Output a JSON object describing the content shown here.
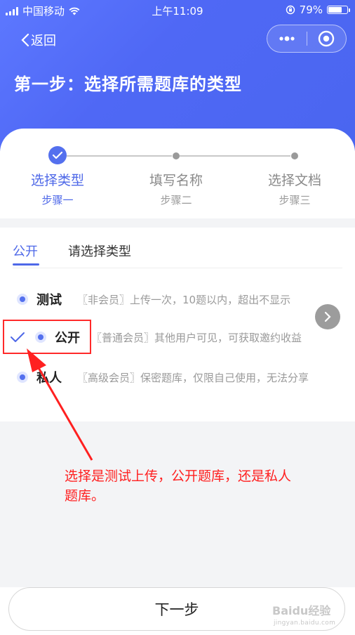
{
  "status_bar": {
    "carrier": "中国移动",
    "time": "上午11:09",
    "battery_text": "79%",
    "battery_level": 0.79
  },
  "nav": {
    "back_label": "返回",
    "more_icon": "more-dots-icon",
    "close_icon": "target-circle-icon"
  },
  "header": {
    "title": "第一步：选择所需题库的类型"
  },
  "steps": [
    {
      "label": "选择类型",
      "sub": "步骤一",
      "state": "done"
    },
    {
      "label": "填写名称",
      "sub": "步骤二",
      "state": "pending"
    },
    {
      "label": "选择文档",
      "sub": "步骤三",
      "state": "pending"
    }
  ],
  "type_section": {
    "active_tab": "公开",
    "prompt": "请选择类型",
    "options": [
      {
        "name": "测试",
        "desc": "〖非会员〗上传一次，10题以内，超出不显示"
      },
      {
        "name": "公开",
        "desc": "〖普通会员〗其他用户可见，可获取邀约收益"
      },
      {
        "name": "私人",
        "desc": "〖高级会员〗保密题库，仅限自己使用，无法分享"
      }
    ]
  },
  "annotation": {
    "text": "选择是测试上传，公开题库，还是私人题库。"
  },
  "footer": {
    "next_label": "下一步"
  },
  "watermark": {
    "brand": "Baidu经验",
    "url": "jingyan.baidu.com"
  },
  "colors": {
    "accent": "#4e68e8",
    "header_gradient_start": "#5d78ff",
    "header_gradient_end": "#4a66f0",
    "annotation_red": "#ff2020"
  }
}
